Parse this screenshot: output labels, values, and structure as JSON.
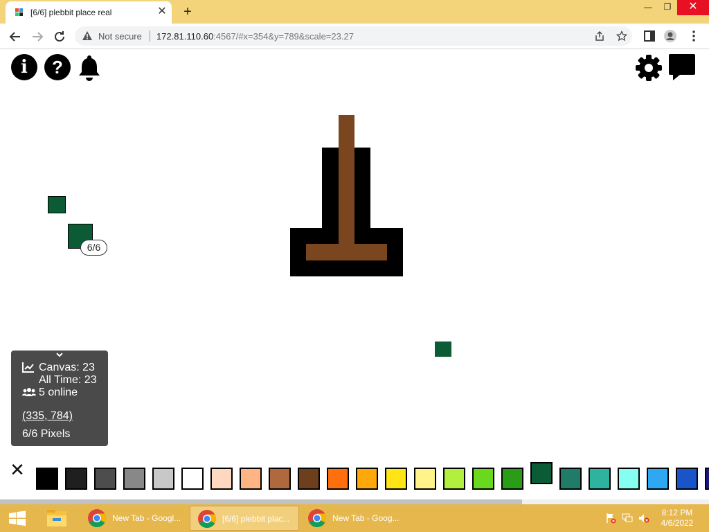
{
  "browser": {
    "tab_title": "[6/6] plebbit place real",
    "url_host": "172.81.110.60",
    "url_rest": ":4567/#x=354&y=789&scale=23.27",
    "security_label": "Not secure"
  },
  "app": {
    "pixel_badge": "6/6",
    "stats": {
      "canvas": "Canvas: 23",
      "all_time": "All Time: 23",
      "online": "5 online",
      "coords": "(335, 784)",
      "pixels": "6/6 Pixels"
    },
    "palette": [
      "#000000",
      "#1f1f1f",
      "#4d4d4d",
      "#888888",
      "#c8c8c8",
      "#ffffff",
      "#ffd8c0",
      "#ffb483",
      "#b0683f",
      "#6e3f1c",
      "#ff6f0e",
      "#ffa80c",
      "#ffe516",
      "#fff38a",
      "#b2f03e",
      "#6ad81d",
      "#2a9d17",
      "#0b5c36",
      "#217b69",
      "#2db3a0",
      "#86fff1",
      "#2ea8f2",
      "#1954c9",
      "#1c1780"
    ],
    "selected_color": "#0b5c36",
    "canvas_colors": {
      "brown": "#7a4620",
      "black": "#000000",
      "green": "#0b5c36"
    }
  },
  "taskbar": {
    "items": [
      {
        "label": "New Tab - Googl..."
      },
      {
        "label": "[6/6] plebbit plac..."
      },
      {
        "label": "New Tab - Goog..."
      }
    ],
    "time": "8:12 PM",
    "date": "4/6/2022"
  }
}
